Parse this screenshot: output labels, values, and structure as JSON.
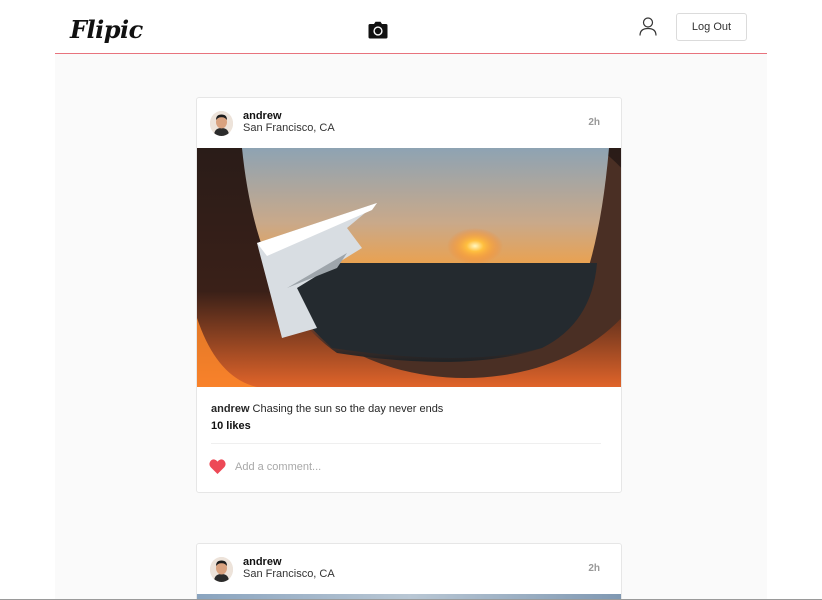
{
  "nav": {
    "logo": "Flipic",
    "camera_icon": "camera-icon",
    "user_icon": "user-icon",
    "logout_label": "Log Out",
    "accent_color": "#e8737d"
  },
  "posts": [
    {
      "username": "andrew",
      "location": "San Francisco, CA",
      "time": "2h",
      "caption_user": "andrew",
      "caption": "Chasing the sun so the day never ends",
      "likes": "10 likes",
      "comment_placeholder": "Add a comment...",
      "heart_icon": "heart-icon",
      "heart_color": "#ed4956"
    },
    {
      "username": "andrew",
      "location": "San Francisco, CA",
      "time": "2h"
    }
  ]
}
